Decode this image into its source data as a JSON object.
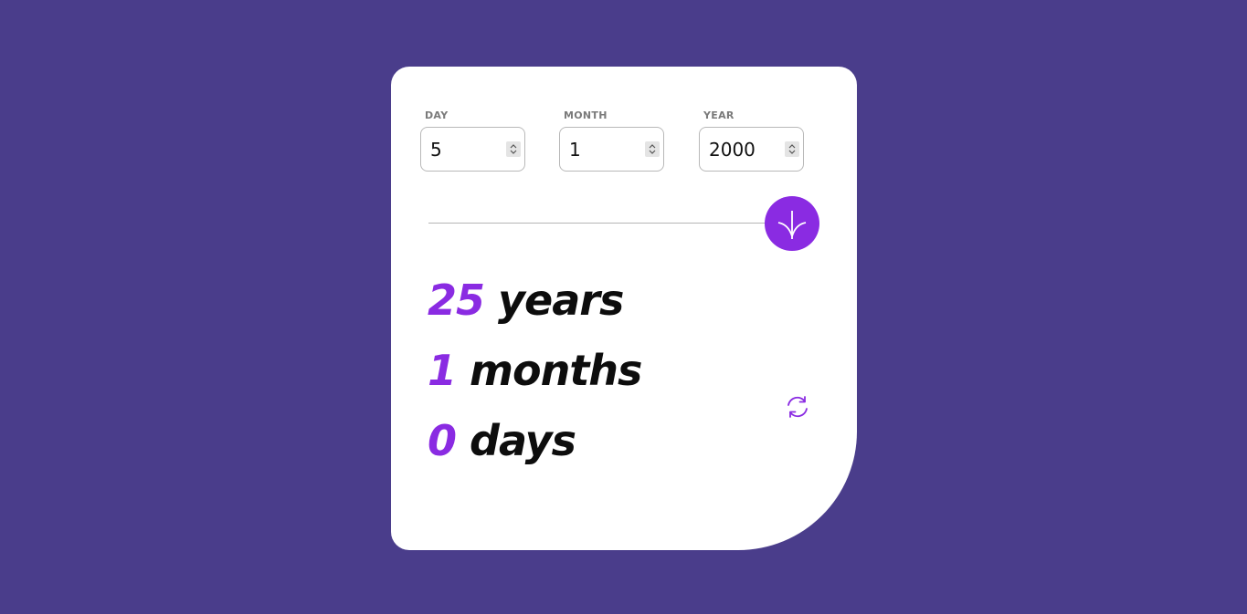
{
  "form": {
    "day": {
      "label": "DAY",
      "value": "5"
    },
    "month": {
      "label": "MONTH",
      "value": "1"
    },
    "year": {
      "label": "YEAR",
      "value": "2000"
    }
  },
  "submit": {
    "icon": "arrow-down-icon"
  },
  "results": {
    "years": {
      "value": "25",
      "unit": "years"
    },
    "months": {
      "value": "1",
      "unit": "months"
    },
    "days": {
      "value": "0",
      "unit": "days"
    }
  },
  "reset": {
    "icon": "refresh-icon"
  },
  "colors": {
    "background": "#4a3d8b",
    "card": "#ffffff",
    "accent": "#8a2be2",
    "text": "#0d0d0d",
    "label": "#7a7a7a"
  }
}
